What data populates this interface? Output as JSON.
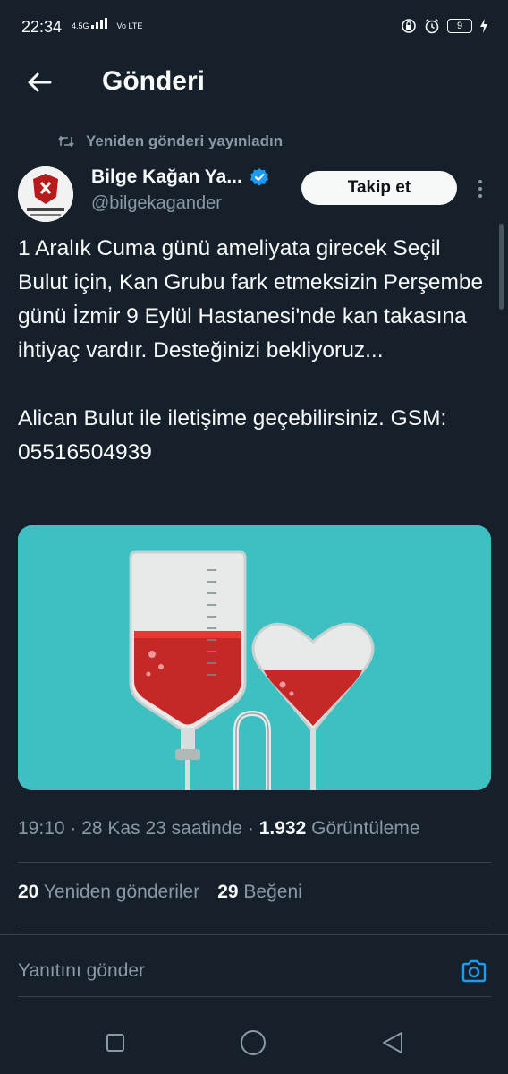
{
  "status_bar": {
    "time": "22:34",
    "network": "Vo LTE",
    "signal_label": "4.5G",
    "battery": "9"
  },
  "header": {
    "title": "Gönderi"
  },
  "repost": {
    "label": "Yeniden gönderi yayınladın"
  },
  "author": {
    "name": "Bilge Kağan Ya...",
    "handle": "@bilgekagander",
    "avatar_text": "BİLGE KAĞAN"
  },
  "follow_button": "Takip et",
  "post": {
    "text": "1 Aralık Cuma günü ameliyata girecek Seçil Bulut için, Kan Grubu fark etmeksizin Perşembe günü İzmir 9 Eylül Hastanesi'nde kan takasına ihtiyaç vardır. Desteğinizi bekliyoruz...\n\nAlican Bulut ile iletişime geçebilirsiniz. GSM: 05516504939"
  },
  "meta": {
    "time": "19:10",
    "date": "28 Kas 23 saatinde",
    "views_count": "1.932",
    "views_label": "Görüntüleme"
  },
  "stats": {
    "reposts_count": "20",
    "reposts_label": "Yeniden gönderiler",
    "likes_count": "29",
    "likes_label": "Beğeni"
  },
  "reply": {
    "placeholder": "Yanıtını gönder"
  },
  "colors": {
    "background": "#15202b",
    "accent": "#1d9bf0",
    "muted": "#8b98a5",
    "media_bg": "#3ebfc2",
    "blood": "#c62828"
  }
}
